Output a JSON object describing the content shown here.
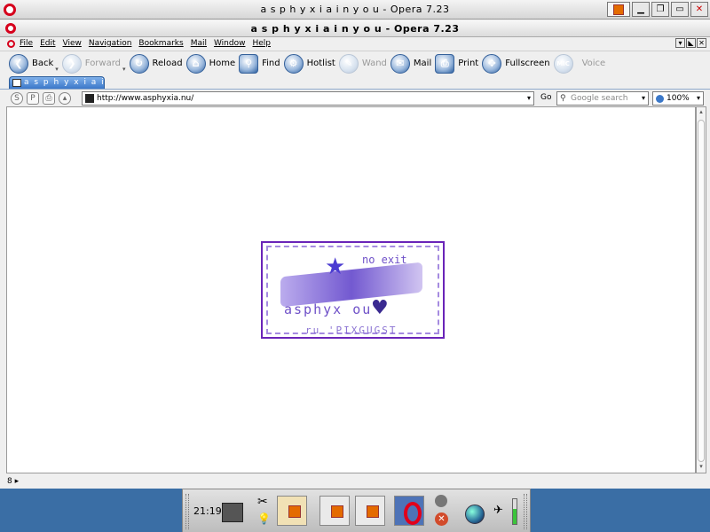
{
  "window": {
    "title": "a s p h y x i a i n y o u - Opera 7.23",
    "title_bold": "a s p h y x i a i n y o u - Opera 7.23"
  },
  "menu": {
    "items": [
      "File",
      "Edit",
      "View",
      "Navigation",
      "Bookmarks",
      "Mail",
      "Window",
      "Help"
    ]
  },
  "toolbar": {
    "buttons": [
      {
        "label": "Back",
        "icon": "back-arrow-icon",
        "enabled": true
      },
      {
        "label": "Forward",
        "icon": "forward-arrow-icon",
        "enabled": false
      },
      {
        "label": "Reload",
        "icon": "reload-icon",
        "enabled": true
      },
      {
        "label": "Home",
        "icon": "home-icon",
        "enabled": true
      },
      {
        "label": "Find",
        "icon": "magnifier-icon",
        "enabled": true
      },
      {
        "label": "Hotlist",
        "icon": "gear-icon",
        "enabled": true
      },
      {
        "label": "Wand",
        "icon": "wand-icon",
        "enabled": false
      },
      {
        "label": "Mail",
        "icon": "mail-icon",
        "enabled": true
      },
      {
        "label": "Print",
        "icon": "printer-icon",
        "enabled": true
      },
      {
        "label": "Fullscreen",
        "icon": "fullscreen-icon",
        "enabled": true
      },
      {
        "label": "Voice",
        "icon": "mic-icon",
        "enabled": false
      }
    ]
  },
  "tabs": [
    {
      "label": "a s p h y x i a i n y o u",
      "active": true
    }
  ],
  "address": {
    "url": "http://www.asphyxia.nu/",
    "go_label": "Go",
    "search_placeholder": "Google search",
    "zoom": "100%"
  },
  "page": {
    "stamp_text_top": "no exit",
    "stamp_text_middle": "asphyx ou",
    "stamp_text_bottom": "ru 'PIXGUGST"
  },
  "status": {
    "text": ""
  },
  "taskbar": {
    "clock": "21:19"
  },
  "colors": {
    "tab_active": "#3b78c9",
    "stamp_purple": "#6a24b8",
    "opera_red": "#d6001c",
    "desktop": "#3a6ea5"
  }
}
